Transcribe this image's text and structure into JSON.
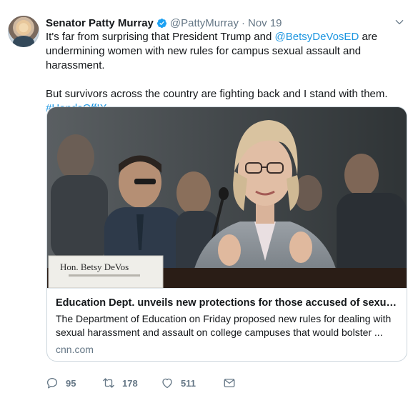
{
  "author": {
    "name": "Senator Patty Murray",
    "handle": "@PattyMurray",
    "separator": "·",
    "date": "Nov 19"
  },
  "tweet": {
    "line1_a": "It's far from surprising that President Trump and ",
    "line1_mention": "@BetsyDeVosED",
    "line1_b": " are undermining women with new rules for campus sexual assault and harassment.",
    "line2": "But survivors across the country are fighting back and I stand with them.",
    "hashtag": "#HandsOffIX"
  },
  "card": {
    "nameplate": "Hon. Betsy DeVos",
    "title": "Education Dept. unveils new protections for those accused of sexual...",
    "description": "The Department of Education on Friday proposed new rules for dealing with sexual harassment and assault on college campuses that would bolster ...",
    "domain": "cnn.com"
  },
  "actions": {
    "reply_count": "95",
    "retweet_count": "178",
    "like_count": "511"
  },
  "icons": {
    "verified": "verified-badge-icon",
    "more": "chevron-down-icon",
    "reply": "reply-icon",
    "retweet": "retweet-icon",
    "like": "heart-icon",
    "message": "envelope-icon"
  },
  "colors": {
    "link": "#1b95e0",
    "secondary_text": "#657786",
    "verified": "#1da1f2"
  }
}
